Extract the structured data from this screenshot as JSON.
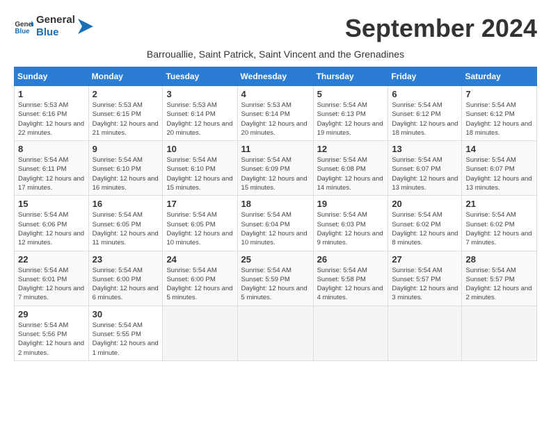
{
  "logo": {
    "line1": "General",
    "line2": "Blue"
  },
  "title": "September 2024",
  "subtitle": "Barrouallie, Saint Patrick, Saint Vincent and the Grenadines",
  "days_of_week": [
    "Sunday",
    "Monday",
    "Tuesday",
    "Wednesday",
    "Thursday",
    "Friday",
    "Saturday"
  ],
  "weeks": [
    [
      {
        "day": "1",
        "sunrise": "5:53 AM",
        "sunset": "6:16 PM",
        "daylight": "12 hours and 22 minutes."
      },
      {
        "day": "2",
        "sunrise": "5:53 AM",
        "sunset": "6:15 PM",
        "daylight": "12 hours and 21 minutes."
      },
      {
        "day": "3",
        "sunrise": "5:53 AM",
        "sunset": "6:14 PM",
        "daylight": "12 hours and 20 minutes."
      },
      {
        "day": "4",
        "sunrise": "5:53 AM",
        "sunset": "6:14 PM",
        "daylight": "12 hours and 20 minutes."
      },
      {
        "day": "5",
        "sunrise": "5:54 AM",
        "sunset": "6:13 PM",
        "daylight": "12 hours and 19 minutes."
      },
      {
        "day": "6",
        "sunrise": "5:54 AM",
        "sunset": "6:12 PM",
        "daylight": "12 hours and 18 minutes."
      },
      {
        "day": "7",
        "sunrise": "5:54 AM",
        "sunset": "6:12 PM",
        "daylight": "12 hours and 18 minutes."
      }
    ],
    [
      {
        "day": "8",
        "sunrise": "5:54 AM",
        "sunset": "6:11 PM",
        "daylight": "12 hours and 17 minutes."
      },
      {
        "day": "9",
        "sunrise": "5:54 AM",
        "sunset": "6:10 PM",
        "daylight": "12 hours and 16 minutes."
      },
      {
        "day": "10",
        "sunrise": "5:54 AM",
        "sunset": "6:10 PM",
        "daylight": "12 hours and 15 minutes."
      },
      {
        "day": "11",
        "sunrise": "5:54 AM",
        "sunset": "6:09 PM",
        "daylight": "12 hours and 15 minutes."
      },
      {
        "day": "12",
        "sunrise": "5:54 AM",
        "sunset": "6:08 PM",
        "daylight": "12 hours and 14 minutes."
      },
      {
        "day": "13",
        "sunrise": "5:54 AM",
        "sunset": "6:07 PM",
        "daylight": "12 hours and 13 minutes."
      },
      {
        "day": "14",
        "sunrise": "5:54 AM",
        "sunset": "6:07 PM",
        "daylight": "12 hours and 13 minutes."
      }
    ],
    [
      {
        "day": "15",
        "sunrise": "5:54 AM",
        "sunset": "6:06 PM",
        "daylight": "12 hours and 12 minutes."
      },
      {
        "day": "16",
        "sunrise": "5:54 AM",
        "sunset": "6:05 PM",
        "daylight": "12 hours and 11 minutes."
      },
      {
        "day": "17",
        "sunrise": "5:54 AM",
        "sunset": "6:05 PM",
        "daylight": "12 hours and 10 minutes."
      },
      {
        "day": "18",
        "sunrise": "5:54 AM",
        "sunset": "6:04 PM",
        "daylight": "12 hours and 10 minutes."
      },
      {
        "day": "19",
        "sunrise": "5:54 AM",
        "sunset": "6:03 PM",
        "daylight": "12 hours and 9 minutes."
      },
      {
        "day": "20",
        "sunrise": "5:54 AM",
        "sunset": "6:02 PM",
        "daylight": "12 hours and 8 minutes."
      },
      {
        "day": "21",
        "sunrise": "5:54 AM",
        "sunset": "6:02 PM",
        "daylight": "12 hours and 7 minutes."
      }
    ],
    [
      {
        "day": "22",
        "sunrise": "5:54 AM",
        "sunset": "6:01 PM",
        "daylight": "12 hours and 7 minutes."
      },
      {
        "day": "23",
        "sunrise": "5:54 AM",
        "sunset": "6:00 PM",
        "daylight": "12 hours and 6 minutes."
      },
      {
        "day": "24",
        "sunrise": "5:54 AM",
        "sunset": "6:00 PM",
        "daylight": "12 hours and 5 minutes."
      },
      {
        "day": "25",
        "sunrise": "5:54 AM",
        "sunset": "5:59 PM",
        "daylight": "12 hours and 5 minutes."
      },
      {
        "day": "26",
        "sunrise": "5:54 AM",
        "sunset": "5:58 PM",
        "daylight": "12 hours and 4 minutes."
      },
      {
        "day": "27",
        "sunrise": "5:54 AM",
        "sunset": "5:57 PM",
        "daylight": "12 hours and 3 minutes."
      },
      {
        "day": "28",
        "sunrise": "5:54 AM",
        "sunset": "5:57 PM",
        "daylight": "12 hours and 2 minutes."
      }
    ],
    [
      {
        "day": "29",
        "sunrise": "5:54 AM",
        "sunset": "5:56 PM",
        "daylight": "12 hours and 2 minutes."
      },
      {
        "day": "30",
        "sunrise": "5:54 AM",
        "sunset": "5:55 PM",
        "daylight": "12 hours and 1 minute."
      },
      null,
      null,
      null,
      null,
      null
    ]
  ]
}
